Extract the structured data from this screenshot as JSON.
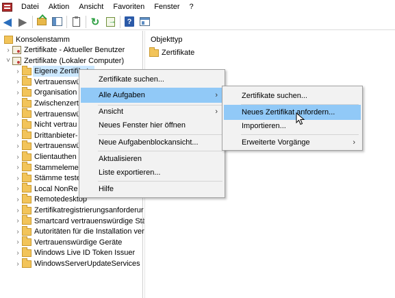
{
  "menubar": {
    "items": [
      "Datei",
      "Aktion",
      "Ansicht",
      "Favoriten",
      "Fenster",
      "?"
    ]
  },
  "toolbar": {
    "icons": [
      "back-arrow-icon",
      "forward-arrow-icon",
      "up-folder-icon",
      "show-hide-tree-icon",
      "properties-icon",
      "refresh-icon",
      "export-list-icon",
      "help-icon",
      "show-hide-action-pane-icon"
    ]
  },
  "tree": {
    "root": "Konsolenstamm",
    "items": [
      {
        "label": "Zertifikate - Aktueller Benutzer",
        "level": 1,
        "icon": "cert"
      },
      {
        "label": "Zertifikate (Lokaler Computer)",
        "level": 1,
        "icon": "cert",
        "expanded": true
      },
      {
        "label": "Eigene Zertifikate",
        "level": 2,
        "icon": "folder",
        "selected": true
      },
      {
        "label": "Vertrauenswü",
        "level": 2,
        "icon": "folder"
      },
      {
        "label": "Organisation",
        "level": 2,
        "icon": "folder"
      },
      {
        "label": "Zwischenzert",
        "level": 2,
        "icon": "folder"
      },
      {
        "label": "Vertrauenswü",
        "level": 2,
        "icon": "folder"
      },
      {
        "label": "Nicht vertrau",
        "level": 2,
        "icon": "folder"
      },
      {
        "label": "Drittanbieter-",
        "level": 2,
        "icon": "folder"
      },
      {
        "label": "Vertrauenswü",
        "level": 2,
        "icon": "folder"
      },
      {
        "label": "Clientauthen",
        "level": 2,
        "icon": "folder"
      },
      {
        "label": "Stammeleme",
        "level": 2,
        "icon": "folder"
      },
      {
        "label": "Stämme teste",
        "level": 2,
        "icon": "folder"
      },
      {
        "label": "Local NonRe",
        "level": 2,
        "icon": "folder"
      },
      {
        "label": "Remotedesktop",
        "level": 2,
        "icon": "folder"
      },
      {
        "label": "Zertifikatregistrierungsanforderur",
        "level": 2,
        "icon": "folder"
      },
      {
        "label": "Smartcard vertrauenswürdige Stär",
        "level": 2,
        "icon": "folder"
      },
      {
        "label": "Autoritäten für die Installation ver",
        "level": 2,
        "icon": "folder"
      },
      {
        "label": "Vertrauenswürdige Geräte",
        "level": 2,
        "icon": "folder"
      },
      {
        "label": "Windows Live ID Token Issuer",
        "level": 2,
        "icon": "folder"
      },
      {
        "label": "WindowsServerUpdateServices",
        "level": 2,
        "icon": "folder"
      }
    ]
  },
  "right_pane": {
    "column_header": "Objekttyp",
    "items": [
      "Zertifikate"
    ]
  },
  "context_menu": {
    "items": [
      {
        "label": "Zertifikate suchen...",
        "submenu": false
      },
      {
        "label": "Alle Aufgaben",
        "submenu": true,
        "highlighted": true
      },
      {
        "label": "Ansicht",
        "submenu": true
      },
      {
        "label": "Neues Fenster hier öffnen",
        "submenu": false
      },
      {
        "label": "Neue Aufgabenblockansicht...",
        "submenu": false
      },
      {
        "label": "Aktualisieren",
        "submenu": false
      },
      {
        "label": "Liste exportieren...",
        "submenu": false
      },
      {
        "label": "Hilfe",
        "submenu": false
      }
    ]
  },
  "submenu": {
    "items": [
      {
        "label": "Zertifikate suchen...",
        "submenu": false
      },
      {
        "label": "Neues Zertifikat anfordern...",
        "submenu": false,
        "highlighted": true
      },
      {
        "label": "Importieren...",
        "submenu": false
      },
      {
        "label": "Erweiterte Vorgänge",
        "submenu": true
      }
    ]
  },
  "colors": {
    "highlight": "#91c9f7",
    "selection": "#cce8ff",
    "menu_background": "#f2f2f2",
    "folder": "#f2c45a"
  }
}
